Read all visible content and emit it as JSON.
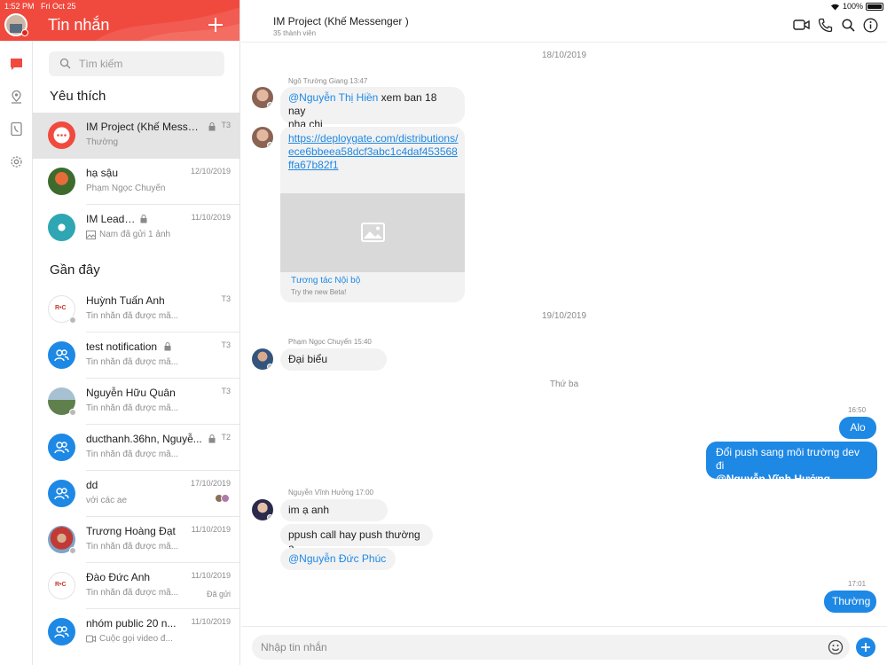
{
  "status": {
    "time": "1:52 PM",
    "date": "Fri Oct 25",
    "battery": "100%"
  },
  "colors": {
    "brand": "#f04a3f",
    "accent": "#1e88e5",
    "presence_red": "#e1261c"
  },
  "list": {
    "title": "Tin nhắn",
    "search_placeholder": "Tìm kiếm",
    "favorites_title": "Yêu thích",
    "recent_title": "Gần đây",
    "favorites": [
      {
        "name": "IM Project (Khế Messenger )",
        "sub": "Thường",
        "time": "T3",
        "avatar": "chat-bubble-icon"
      },
      {
        "name": "hạ sậu",
        "sub": "Phạm Ngọc Chuyển",
        "time": "12/10/2019",
        "avatar": "photo"
      },
      {
        "name": "IM Leaders",
        "sub": "Nam đã gửi 1 ảnh",
        "time": "11/10/2019",
        "avatar": "photo",
        "sub_icon": "image-icon"
      }
    ],
    "recent": [
      {
        "name": "Huỳnh Tuấn Anh",
        "sub": "Tin nhắn đã được mã...",
        "time": "T3",
        "avatar": "logo",
        "logo": "R•C"
      },
      {
        "name": "test notification",
        "sub": "Tin nhắn đã được mã...",
        "time": "T3",
        "avatar": "group-icon"
      },
      {
        "name": "Nguyễn Hữu Quân",
        "sub": "Tin nhắn đã được mã...",
        "time": "T3",
        "avatar": "photo"
      },
      {
        "name": "ducthanh.36hn, Nguyễ...",
        "sub": "Tin nhắn đã được mã...",
        "time": "T2",
        "avatar": "group-icon"
      },
      {
        "name": "dd",
        "sub": "với các ae",
        "time": "17/10/2019",
        "avatar": "group-icon"
      },
      {
        "name": "Trương Hoàng Đạt",
        "sub": "Tin nhắn đã được mã...",
        "time": "11/10/2019",
        "avatar": "photo"
      },
      {
        "name": "Đào Đức Anh",
        "sub": "Tin nhắn đã được mã...",
        "time": "11/10/2019",
        "avatar": "logo",
        "logo": "R•C",
        "status": "Đã gửi"
      },
      {
        "name": "nhóm public 20 n...",
        "sub": "Cuộc gọi video đ...",
        "time": "11/10/2019",
        "avatar": "group-icon",
        "sub_icon": "video-icon"
      }
    ]
  },
  "chat": {
    "title": "IM Project (Khế Messenger )",
    "subtitle": "35 thành viên",
    "composer_placeholder": "Nhập tin nhắn",
    "dates": [
      "18/10/2019",
      "19/10/2019",
      "Thứ ba"
    ],
    "messages": {
      "m1_sender": "Ngô Trường Giang 13:47",
      "m1_mention": "@Nguyễn Thị Hiền",
      "m1_text1": " xem ban 18 nay",
      "m1_text2": "nha chi",
      "m2_url": "https://deploygate.com/distributions/ece6bbeea58dcf3abc1c4daf453568ffa67b82f1",
      "m2_card_title": "Tương tác Nội bộ",
      "m2_card_desc": "Try the new Beta!",
      "m3_sender": "Phạm Ngọc Chuyển 15:40",
      "m3_text": "Đại biểu",
      "out1_time": "16:50",
      "out1_text": "Alo",
      "out2_text": "Đổi push sang môi trường dev đi",
      "out2_mention": "@Nguyễn Vĩnh Hưởng",
      "m4_sender": "Nguyễn Vĩnh Hưởng 17:00",
      "m4_text": "im ạ anh",
      "m5_text": "ppush call hay push thường ạ",
      "m6_mention": "@Nguyễn Đức Phúc",
      "out3_time": "17:01",
      "out3_text": "Thường"
    }
  }
}
